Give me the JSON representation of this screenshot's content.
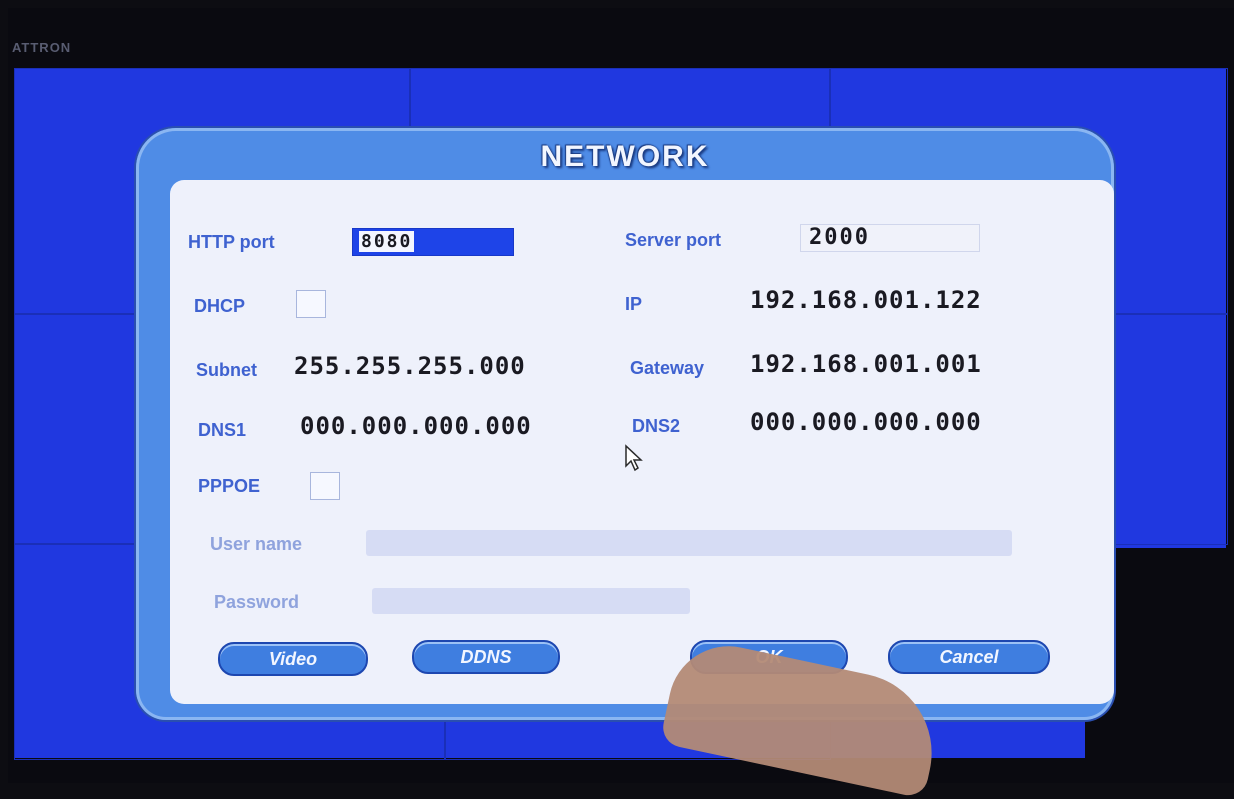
{
  "brand_text": "ATTRON",
  "dialog": {
    "title": "NETWORK",
    "http_port": {
      "label": "HTTP port",
      "value": "8080"
    },
    "server_port": {
      "label": "Server port",
      "value": "2000"
    },
    "dhcp": {
      "label": "DHCP"
    },
    "ip": {
      "label": "IP",
      "value": "192.168.001.122"
    },
    "subnet": {
      "label": "Subnet",
      "value": "255.255.255.000"
    },
    "gateway": {
      "label": "Gateway",
      "value": "192.168.001.001"
    },
    "dns1": {
      "label": "DNS1",
      "value": "000.000.000.000"
    },
    "dns2": {
      "label": "DNS2",
      "value": "000.000.000.000"
    },
    "pppoe": {
      "label": "PPPOE"
    },
    "username": {
      "label": "User name",
      "value": ""
    },
    "password": {
      "label": "Password",
      "value": ""
    },
    "buttons": {
      "video": "Video",
      "ddns": "DDNS",
      "ok": "OK",
      "cancel": "Cancel"
    }
  },
  "colors": {
    "background_blue": "#2038e0",
    "dialog_blue": "#4f8ce6",
    "panel": "#eef1fb",
    "label": "#3f62d0"
  }
}
